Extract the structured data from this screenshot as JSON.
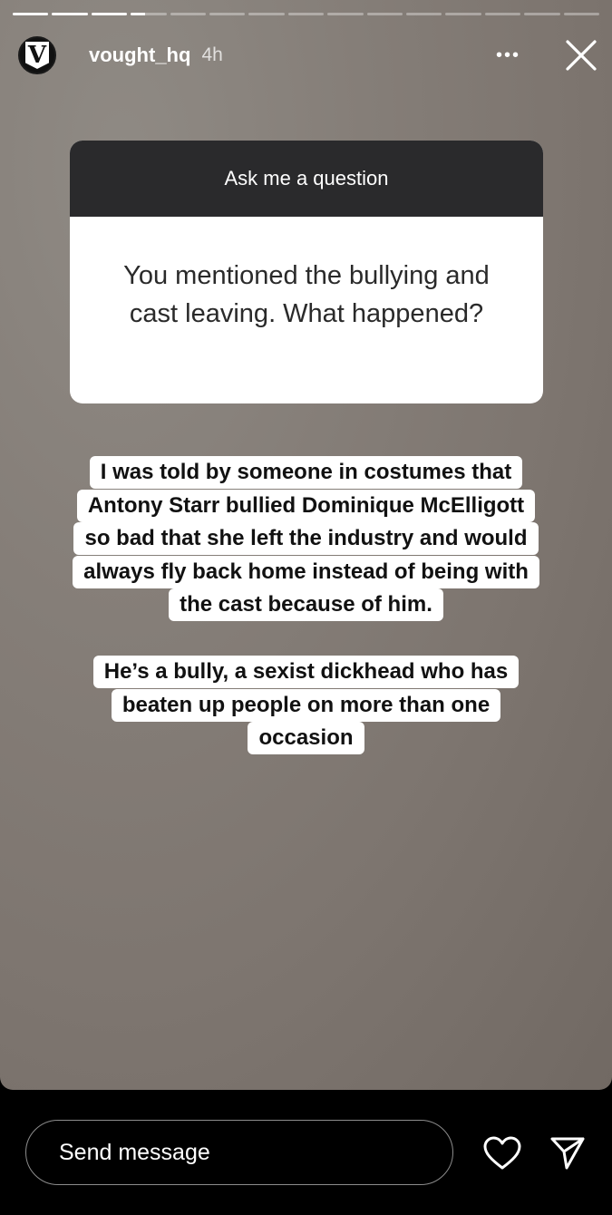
{
  "story": {
    "progress_segments": [
      {
        "fill": 1.0
      },
      {
        "fill": 1.0
      },
      {
        "fill": 1.0
      },
      {
        "fill": 0.4
      },
      {
        "fill": 0
      },
      {
        "fill": 0
      },
      {
        "fill": 0
      },
      {
        "fill": 0
      },
      {
        "fill": 0
      },
      {
        "fill": 0
      },
      {
        "fill": 0
      },
      {
        "fill": 0
      },
      {
        "fill": 0
      },
      {
        "fill": 0
      },
      {
        "fill": 0
      }
    ],
    "header": {
      "avatar_letter": "V",
      "username": "vought_hq",
      "time": "4h",
      "more_icon": "more-horizontal-icon",
      "close_icon": "close-icon"
    },
    "question_box": {
      "title": "Ask me a question",
      "question": "You mentioned the bullying and cast leaving. What happened?"
    },
    "answer_1": [
      "I was told by someone in costumes that",
      "Antony Starr bullied Dominique McElligott",
      "so bad that she left the industry and would",
      "always fly back home instead of being with",
      "the cast because of him."
    ],
    "answer_2": [
      "He’s a bully, a sexist dickhead who has",
      "beaten up people on more than one",
      "occasion"
    ]
  },
  "bottom_bar": {
    "message_placeholder": "Send message",
    "heart_icon": "heart-icon",
    "send_icon": "send-icon"
  }
}
